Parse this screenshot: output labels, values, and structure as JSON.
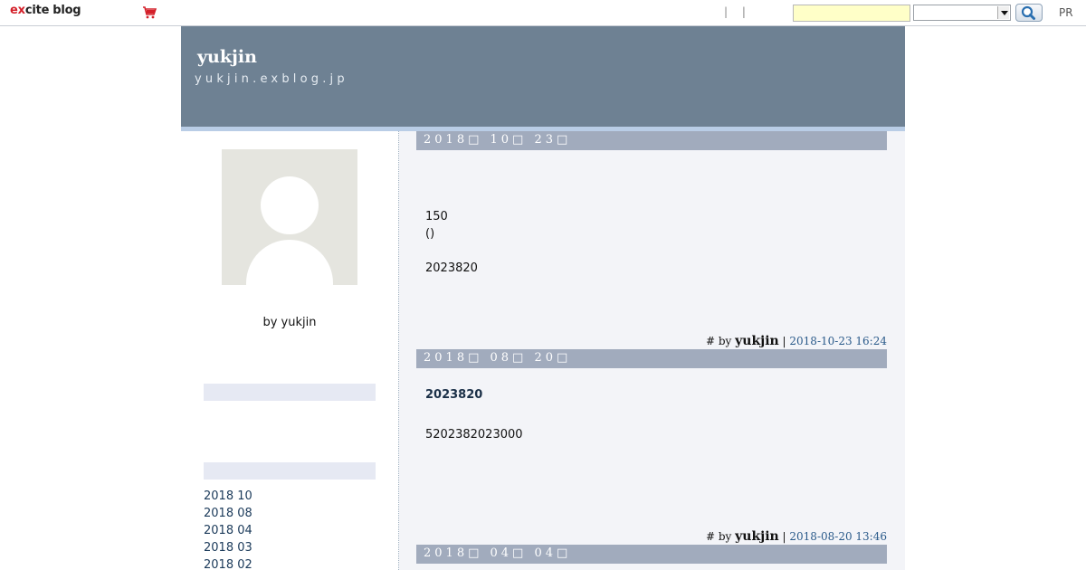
{
  "topbar": {
    "logo_e": "e",
    "logo_x": "x",
    "logo_cite": "cite",
    "logo_blog": "blog",
    "pipes": "| |",
    "search_value": "",
    "select_value": "",
    "pr": "PR"
  },
  "banner": {
    "title": "yukjin",
    "url": "yukjin.exblog.jp"
  },
  "sidebar": {
    "byline": "by yukjin",
    "archive": [
      "2018 10",
      "2018 08",
      "2018 04",
      "2018 03",
      "2018 02"
    ]
  },
  "posts": [
    {
      "date": "2018\u0000 10\u0000 23\u0000",
      "lines": [
        "150",
        "()",
        "",
        "2023820"
      ],
      "footer_hash": "#",
      "footer_by": "by",
      "footer_author": "yukjin",
      "footer_sep": "|",
      "footer_time": "2018-10-23 16:24"
    },
    {
      "date": "2018\u0000 08\u0000 20\u0000",
      "title": "2023820",
      "lines": [
        "5202382023000"
      ],
      "footer_hash": "#",
      "footer_by": "by",
      "footer_author": "yukjin",
      "footer_sep": "|",
      "footer_time": "2018-08-20 13:46"
    },
    {
      "date": "2018\u0000 04\u0000 04\u0000"
    }
  ],
  "colors": {
    "banner": "#6e8193",
    "date_bar": "#a1abbd",
    "main_bg": "#f3f4f8",
    "logo_red": "#d4202a"
  },
  "icons": {
    "cart": "shopping-cart-icon",
    "search": "magnifier-icon",
    "avatar": "default-user-avatar"
  }
}
